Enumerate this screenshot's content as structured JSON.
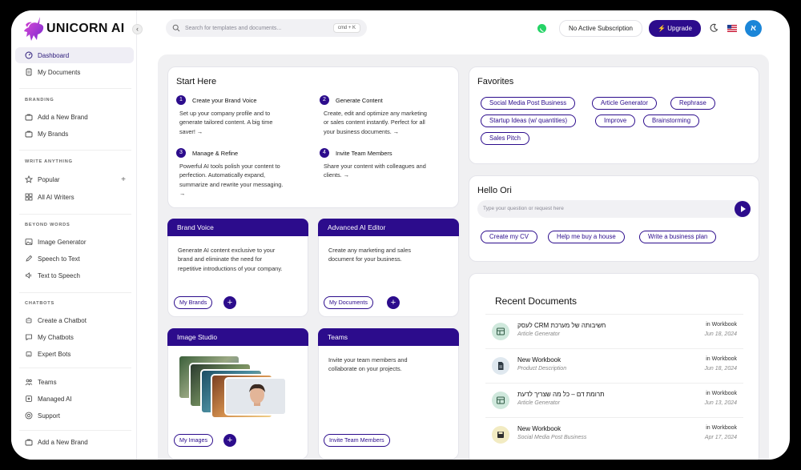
{
  "brand": {
    "name": "UNICORN AI"
  },
  "sidebar": {
    "collapse_icon": "‹",
    "items_top": [
      {
        "label": "Dashboard",
        "icon": "dashboard-icon"
      },
      {
        "label": "My Documents",
        "icon": "document-icon"
      }
    ],
    "sections": [
      {
        "title": "BRANDING",
        "items": [
          "Add a New Brand",
          "My Brands"
        ]
      },
      {
        "title": "WRITE ANYTHING",
        "items": [
          "Popular",
          "All AI Writers"
        ]
      },
      {
        "title": "BEYOND WORDS",
        "items": [
          "Image Generator",
          "Speech to Text",
          "Text to Speech"
        ]
      },
      {
        "title": "CHATBOTS",
        "items": [
          "Create a Chatbot",
          "My Chatbots",
          "Expert Bots"
        ]
      }
    ],
    "items_bottom": [
      "Teams",
      "Managed AI",
      "Support"
    ],
    "items_footer": [
      "Add a New Brand"
    ],
    "plus": "+"
  },
  "topbar": {
    "search_placeholder": "Search for templates and documents...",
    "shortcut": "cmd + K",
    "subscription": "No Active Subscription",
    "upgrade": "Upgrade",
    "avatar_initial": "א"
  },
  "start_here": {
    "title": "Start Here",
    "steps": [
      {
        "num": "1",
        "title": "Create your Brand Voice",
        "desc": [
          "Set up your company profile and to",
          "generate tailored content. A big time",
          "saver! →"
        ]
      },
      {
        "num": "2",
        "title": "Generate Content",
        "desc": [
          "Create, edit and optimize any marketing",
          "or sales content instantly. Perfect for all",
          "your business documents. →"
        ]
      },
      {
        "num": "3",
        "title": "Manage & Refine",
        "desc": [
          "Powerful AI tools polish your content to",
          "perfection. Automatically expand,",
          "summarize and rewrite your messaging.",
          "→"
        ]
      },
      {
        "num": "4",
        "title": "Invite Team Members",
        "desc": [
          "Share your content with colleagues and",
          "clients. →"
        ]
      }
    ]
  },
  "features": [
    {
      "title": "Brand Voice",
      "desc": [
        "Generate AI content exclusive to your",
        "brand and eliminate the need for",
        "repetitive introductions of your company."
      ],
      "button": "My Brands",
      "plus": "+"
    },
    {
      "title": "Advanced AI Editor",
      "desc": [
        "Create any marketing and sales",
        "document for your business."
      ],
      "button": "My Documents",
      "plus": "+"
    },
    {
      "title": "Image Studio",
      "desc": [],
      "button": "My Images",
      "plus": "+"
    },
    {
      "title": "Teams",
      "desc": [
        "Invite your team members and",
        "collaborate on your projects."
      ],
      "button": "Invite Team Members"
    }
  ],
  "favorites": {
    "title": "Favorites",
    "items": [
      "Social Media Post Business",
      "Article Generator",
      "Rephrase",
      "Startup Ideas (w/ quantities)",
      "Improve",
      "Brainstorming",
      "Sales Pitch"
    ]
  },
  "hello": {
    "title": "Hello Ori",
    "placeholder": "Type your question or request here",
    "suggestions": [
      "Create my CV",
      "Help me buy a house",
      "Write a business plan"
    ]
  },
  "recent": {
    "title": "Recent Documents",
    "docs": [
      {
        "title": "לעסק CRM חשיבותה של מערכת",
        "type": "Article Generator",
        "where": "in Workbook",
        "date": "Jun 18, 2024",
        "color": "#cfe8dc",
        "icon": "table-icon"
      },
      {
        "title": "New Workbook",
        "type": "Product Description",
        "where": "in Workbook",
        "date": "Jun 18, 2024",
        "color": "#dfe8ef",
        "icon": "document-icon"
      },
      {
        "title": "תרומת דם – כל מה שצריך לדעת",
        "type": "Article Generator",
        "where": "in Workbook",
        "date": "Jun 13, 2024",
        "color": "#cfe8dc",
        "icon": "table-icon"
      },
      {
        "title": "New Workbook",
        "type": "Social Media Post Business",
        "where": "in Workbook",
        "date": "Apr 17, 2024",
        "color": "#f2ebc2",
        "icon": "save-icon"
      }
    ]
  },
  "colors": {
    "accent": "#2c0c8c",
    "content_bg": "#f0f0f2"
  }
}
